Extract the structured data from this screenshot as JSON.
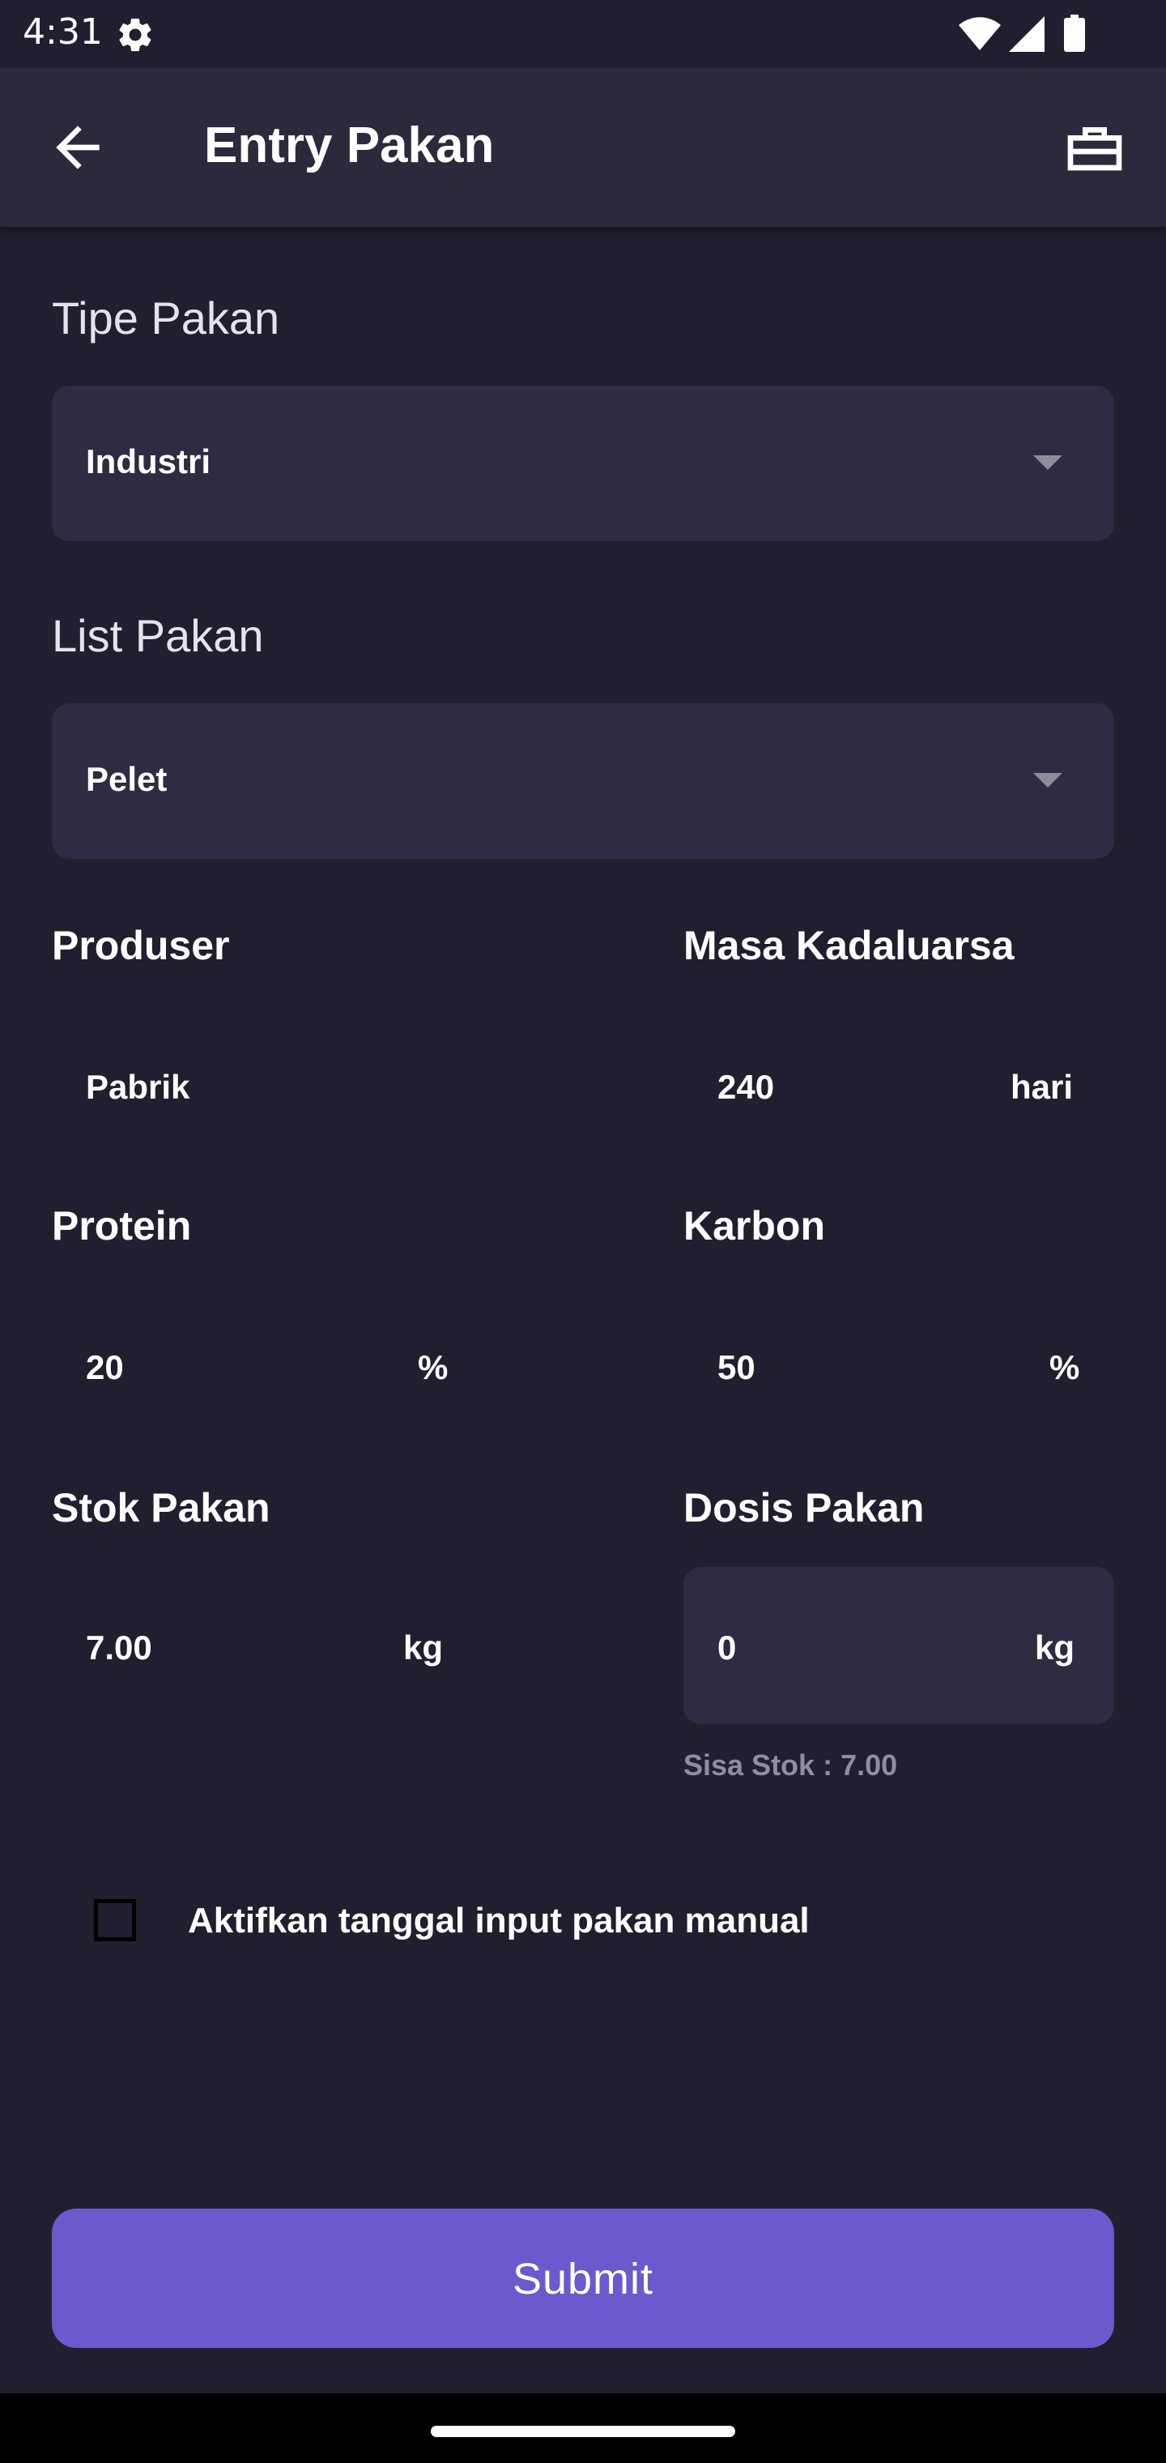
{
  "status_bar": {
    "time": "4:31",
    "icons": [
      "gear-icon",
      "wifi-icon",
      "signal-icon",
      "battery-icon"
    ]
  },
  "app_bar": {
    "title": "Entry Pakan",
    "back_icon": "arrow-left-icon",
    "action_icon": "briefcase-icon"
  },
  "form": {
    "feed_type": {
      "label": "Tipe Pakan",
      "value": "Industri"
    },
    "feed_list": {
      "label": "List Pakan",
      "value": "Pelet"
    },
    "producer": {
      "label": "Produser",
      "value": "Pabrik"
    },
    "expiry": {
      "label": "Masa Kadaluarsa",
      "value": "240",
      "unit": "hari"
    },
    "protein": {
      "label": "Protein",
      "value": "20",
      "unit": "%"
    },
    "carbon": {
      "label": "Karbon",
      "value": "50",
      "unit": "%"
    },
    "stock": {
      "label": "Stok Pakan",
      "value": "7.00",
      "unit": "kg"
    },
    "dose": {
      "label": "Dosis Pakan",
      "value": "0",
      "unit": "kg",
      "hint": "Sisa Stok : 7.00"
    },
    "manual_date": {
      "label": "Aktifkan tanggal input pakan manual",
      "checked": false
    }
  },
  "submit_label": "Submit",
  "colors": {
    "background": "#201f2f",
    "app_bar": "#2b2a3c",
    "field": "#2e2c42",
    "accent": "#6a5acd",
    "hint": "#8f8e9d"
  }
}
